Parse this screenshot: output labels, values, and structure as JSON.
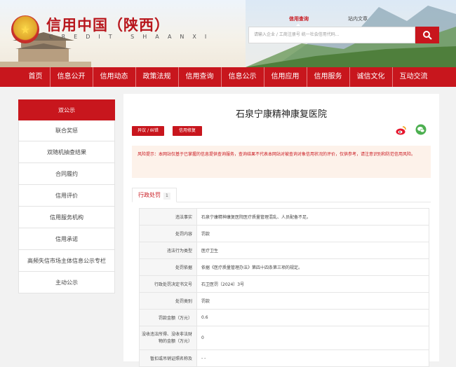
{
  "header": {
    "title": "信用中国（陕西）",
    "subtitle": "CREDIT SHAANXI",
    "search_tabs": [
      "信用查询",
      "站内文章"
    ],
    "search_placeholder": "请输入企业 / 工商注册号 统一社会信用代码..."
  },
  "nav": [
    "首页",
    "信息公开",
    "信用动态",
    "政策法规",
    "信用查询",
    "信息公示",
    "信用应用",
    "信用服务",
    "诚信文化",
    "互动交流"
  ],
  "sidebar": [
    "双公示",
    "联合奖惩",
    "双随机抽查结果",
    "合同履约",
    "信用评价",
    "信用服务机构",
    "信用承诺",
    "高频失信市场主体信息公示专栏",
    "主动公示"
  ],
  "main": {
    "org_name": "石泉宁康精神康复医院",
    "btn_objection": "异议 / 纠错",
    "btn_repair": "信用修复",
    "notice": "风险提示：本网站仅基于已掌握的信息提供查询服务，查询结果不代表本网站对被查询对象信用状况的评价，仅供参考，请注意识别和防范信用风险。",
    "tab_label": "行政处罚",
    "tab_count": "1",
    "rows": [
      {
        "k": "违法事实",
        "v": "石泉宁康精神康复医院医疗质量管理混乱、人员配备不足。"
      },
      {
        "k": "处罚内容",
        "v": "罚款"
      },
      {
        "k": "违法行为类型",
        "v": "医疗卫生"
      },
      {
        "k": "处罚依据",
        "v": "依据《医疗质量管理办法》第四十四条第三项的规定。"
      },
      {
        "k": "行政处罚决定书文号",
        "v": "石卫医罚〔2024〕3号"
      },
      {
        "k": "处罚类别",
        "v": "罚款"
      },
      {
        "k": "罚款金额（万元）",
        "v": "0.6"
      },
      {
        "k": "没收违法所得、没收非法财物的金额（万元）",
        "v": "0"
      },
      {
        "k": "暂扣或吊销证照名称及",
        "v": "- -"
      }
    ]
  }
}
